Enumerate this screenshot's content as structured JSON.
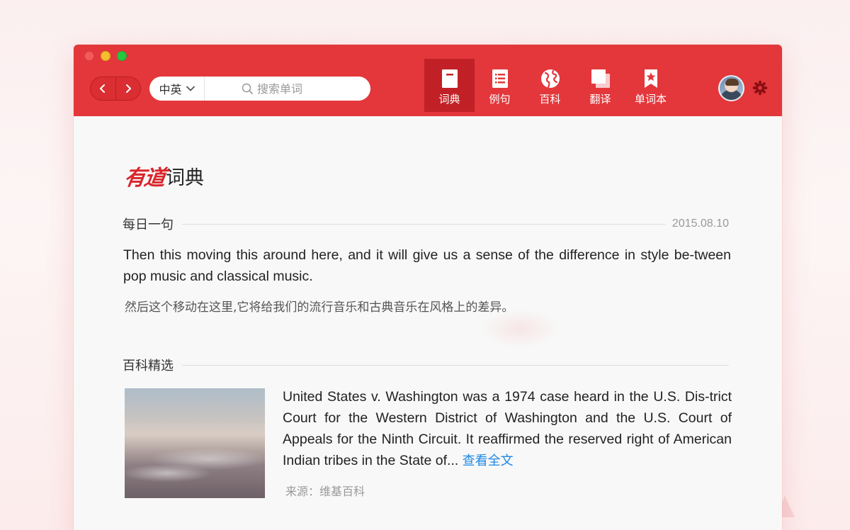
{
  "window": {
    "nav": {
      "back_icon": "chevron-left-icon",
      "forward_icon": "chevron-right-icon"
    },
    "search": {
      "lang_label": "中英",
      "placeholder": "搜索单词",
      "value": ""
    },
    "tabs": [
      {
        "label": "词典",
        "icon": "dictionary-icon",
        "active": true
      },
      {
        "label": "例句",
        "icon": "list-icon",
        "active": false
      },
      {
        "label": "百科",
        "icon": "globe-icon",
        "active": false
      },
      {
        "label": "翻译",
        "icon": "translate-icon",
        "active": false
      },
      {
        "label": "单词本",
        "icon": "bookmark-icon",
        "active": false
      }
    ],
    "accent_color": "#e3373b",
    "active_tab_color": "#c12126"
  },
  "content": {
    "logo": {
      "brand": "有道",
      "text": "词典"
    },
    "daily": {
      "title": "每日一句",
      "date": "2015.08.10",
      "english": "Then this moving this around here, and it will give us a sense of the difference in style be-tween pop music and classical music.",
      "chinese": "然后这个移动在这里,它将给我们的流行音乐和古典音乐在风格上的差异。"
    },
    "wiki": {
      "title": "百科精选",
      "text": "United States v. Washington was a 1974 case heard in the U.S. Dis-trict Court for the Western District of Washington and the U.S. Court of Appeals for the Ninth Circuit. It reaffirmed the reserved right of American Indian tribes in the State of...",
      "link": "查看全文",
      "source": "来源：维基百科",
      "link_color": "#1e88e5"
    }
  }
}
